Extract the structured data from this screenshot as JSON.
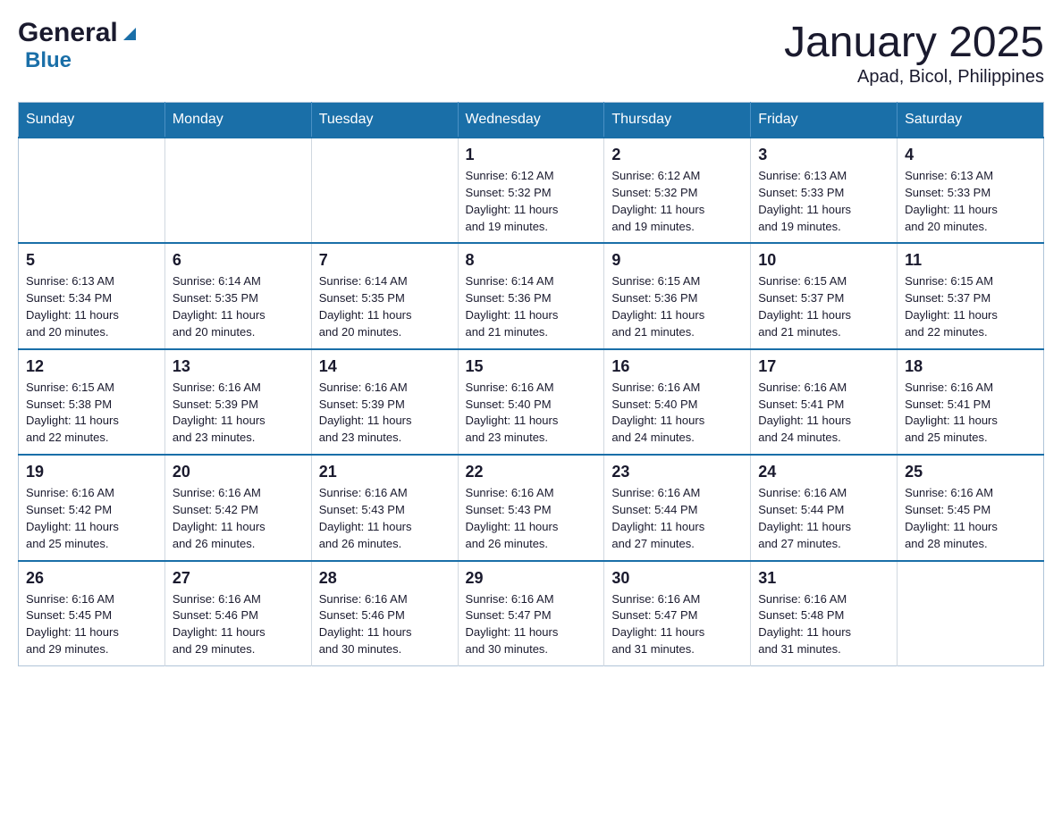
{
  "header": {
    "logo_general": "General",
    "logo_blue": "Blue",
    "title": "January 2025",
    "subtitle": "Apad, Bicol, Philippines"
  },
  "weekdays": [
    "Sunday",
    "Monday",
    "Tuesday",
    "Wednesday",
    "Thursday",
    "Friday",
    "Saturday"
  ],
  "weeks": [
    [
      {
        "day": "",
        "info": ""
      },
      {
        "day": "",
        "info": ""
      },
      {
        "day": "",
        "info": ""
      },
      {
        "day": "1",
        "info": "Sunrise: 6:12 AM\nSunset: 5:32 PM\nDaylight: 11 hours\nand 19 minutes."
      },
      {
        "day": "2",
        "info": "Sunrise: 6:12 AM\nSunset: 5:32 PM\nDaylight: 11 hours\nand 19 minutes."
      },
      {
        "day": "3",
        "info": "Sunrise: 6:13 AM\nSunset: 5:33 PM\nDaylight: 11 hours\nand 19 minutes."
      },
      {
        "day": "4",
        "info": "Sunrise: 6:13 AM\nSunset: 5:33 PM\nDaylight: 11 hours\nand 20 minutes."
      }
    ],
    [
      {
        "day": "5",
        "info": "Sunrise: 6:13 AM\nSunset: 5:34 PM\nDaylight: 11 hours\nand 20 minutes."
      },
      {
        "day": "6",
        "info": "Sunrise: 6:14 AM\nSunset: 5:35 PM\nDaylight: 11 hours\nand 20 minutes."
      },
      {
        "day": "7",
        "info": "Sunrise: 6:14 AM\nSunset: 5:35 PM\nDaylight: 11 hours\nand 20 minutes."
      },
      {
        "day": "8",
        "info": "Sunrise: 6:14 AM\nSunset: 5:36 PM\nDaylight: 11 hours\nand 21 minutes."
      },
      {
        "day": "9",
        "info": "Sunrise: 6:15 AM\nSunset: 5:36 PM\nDaylight: 11 hours\nand 21 minutes."
      },
      {
        "day": "10",
        "info": "Sunrise: 6:15 AM\nSunset: 5:37 PM\nDaylight: 11 hours\nand 21 minutes."
      },
      {
        "day": "11",
        "info": "Sunrise: 6:15 AM\nSunset: 5:37 PM\nDaylight: 11 hours\nand 22 minutes."
      }
    ],
    [
      {
        "day": "12",
        "info": "Sunrise: 6:15 AM\nSunset: 5:38 PM\nDaylight: 11 hours\nand 22 minutes."
      },
      {
        "day": "13",
        "info": "Sunrise: 6:16 AM\nSunset: 5:39 PM\nDaylight: 11 hours\nand 23 minutes."
      },
      {
        "day": "14",
        "info": "Sunrise: 6:16 AM\nSunset: 5:39 PM\nDaylight: 11 hours\nand 23 minutes."
      },
      {
        "day": "15",
        "info": "Sunrise: 6:16 AM\nSunset: 5:40 PM\nDaylight: 11 hours\nand 23 minutes."
      },
      {
        "day": "16",
        "info": "Sunrise: 6:16 AM\nSunset: 5:40 PM\nDaylight: 11 hours\nand 24 minutes."
      },
      {
        "day": "17",
        "info": "Sunrise: 6:16 AM\nSunset: 5:41 PM\nDaylight: 11 hours\nand 24 minutes."
      },
      {
        "day": "18",
        "info": "Sunrise: 6:16 AM\nSunset: 5:41 PM\nDaylight: 11 hours\nand 25 minutes."
      }
    ],
    [
      {
        "day": "19",
        "info": "Sunrise: 6:16 AM\nSunset: 5:42 PM\nDaylight: 11 hours\nand 25 minutes."
      },
      {
        "day": "20",
        "info": "Sunrise: 6:16 AM\nSunset: 5:42 PM\nDaylight: 11 hours\nand 26 minutes."
      },
      {
        "day": "21",
        "info": "Sunrise: 6:16 AM\nSunset: 5:43 PM\nDaylight: 11 hours\nand 26 minutes."
      },
      {
        "day": "22",
        "info": "Sunrise: 6:16 AM\nSunset: 5:43 PM\nDaylight: 11 hours\nand 26 minutes."
      },
      {
        "day": "23",
        "info": "Sunrise: 6:16 AM\nSunset: 5:44 PM\nDaylight: 11 hours\nand 27 minutes."
      },
      {
        "day": "24",
        "info": "Sunrise: 6:16 AM\nSunset: 5:44 PM\nDaylight: 11 hours\nand 27 minutes."
      },
      {
        "day": "25",
        "info": "Sunrise: 6:16 AM\nSunset: 5:45 PM\nDaylight: 11 hours\nand 28 minutes."
      }
    ],
    [
      {
        "day": "26",
        "info": "Sunrise: 6:16 AM\nSunset: 5:45 PM\nDaylight: 11 hours\nand 29 minutes."
      },
      {
        "day": "27",
        "info": "Sunrise: 6:16 AM\nSunset: 5:46 PM\nDaylight: 11 hours\nand 29 minutes."
      },
      {
        "day": "28",
        "info": "Sunrise: 6:16 AM\nSunset: 5:46 PM\nDaylight: 11 hours\nand 30 minutes."
      },
      {
        "day": "29",
        "info": "Sunrise: 6:16 AM\nSunset: 5:47 PM\nDaylight: 11 hours\nand 30 minutes."
      },
      {
        "day": "30",
        "info": "Sunrise: 6:16 AM\nSunset: 5:47 PM\nDaylight: 11 hours\nand 31 minutes."
      },
      {
        "day": "31",
        "info": "Sunrise: 6:16 AM\nSunset: 5:48 PM\nDaylight: 11 hours\nand 31 minutes."
      },
      {
        "day": "",
        "info": ""
      }
    ]
  ]
}
